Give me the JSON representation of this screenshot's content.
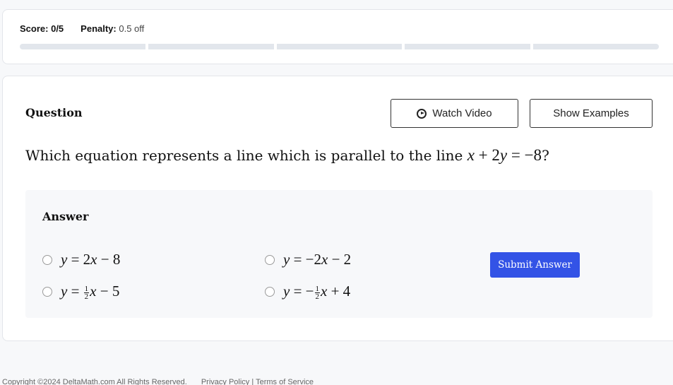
{
  "score": {
    "score_label": "Score:",
    "score_value": "0/5",
    "penalty_label": "Penalty:",
    "penalty_value": "0.5 off",
    "progress": {
      "completed": 0,
      "total": 5
    }
  },
  "question": {
    "heading": "Question",
    "watch_video_label": "Watch Video",
    "show_examples_label": "Show Examples",
    "prompt_text": "Which equation represents a line which is parallel to the line ",
    "prompt_math": "x + 2y = −8",
    "prompt_end": "?"
  },
  "answer": {
    "heading": "Answer",
    "options": [
      {
        "text": "y = 2x − 8",
        "selected": false
      },
      {
        "text": "y = ½x − 5",
        "selected": false
      },
      {
        "text": "y = −2x − 2",
        "selected": false
      },
      {
        "text": "y = −½x + 4",
        "selected": false
      }
    ],
    "submit_label": "Submit Answer"
  },
  "footer": {
    "copyright": "Copyright ©2024 DeltaMath.com All Rights Reserved.",
    "privacy": "Privacy Policy",
    "separator": "|",
    "terms": "Terms of Service"
  },
  "colors": {
    "accent": "#3353e6",
    "progress_track": "#e2e6ec",
    "page_bg": "#f7f8fa"
  }
}
